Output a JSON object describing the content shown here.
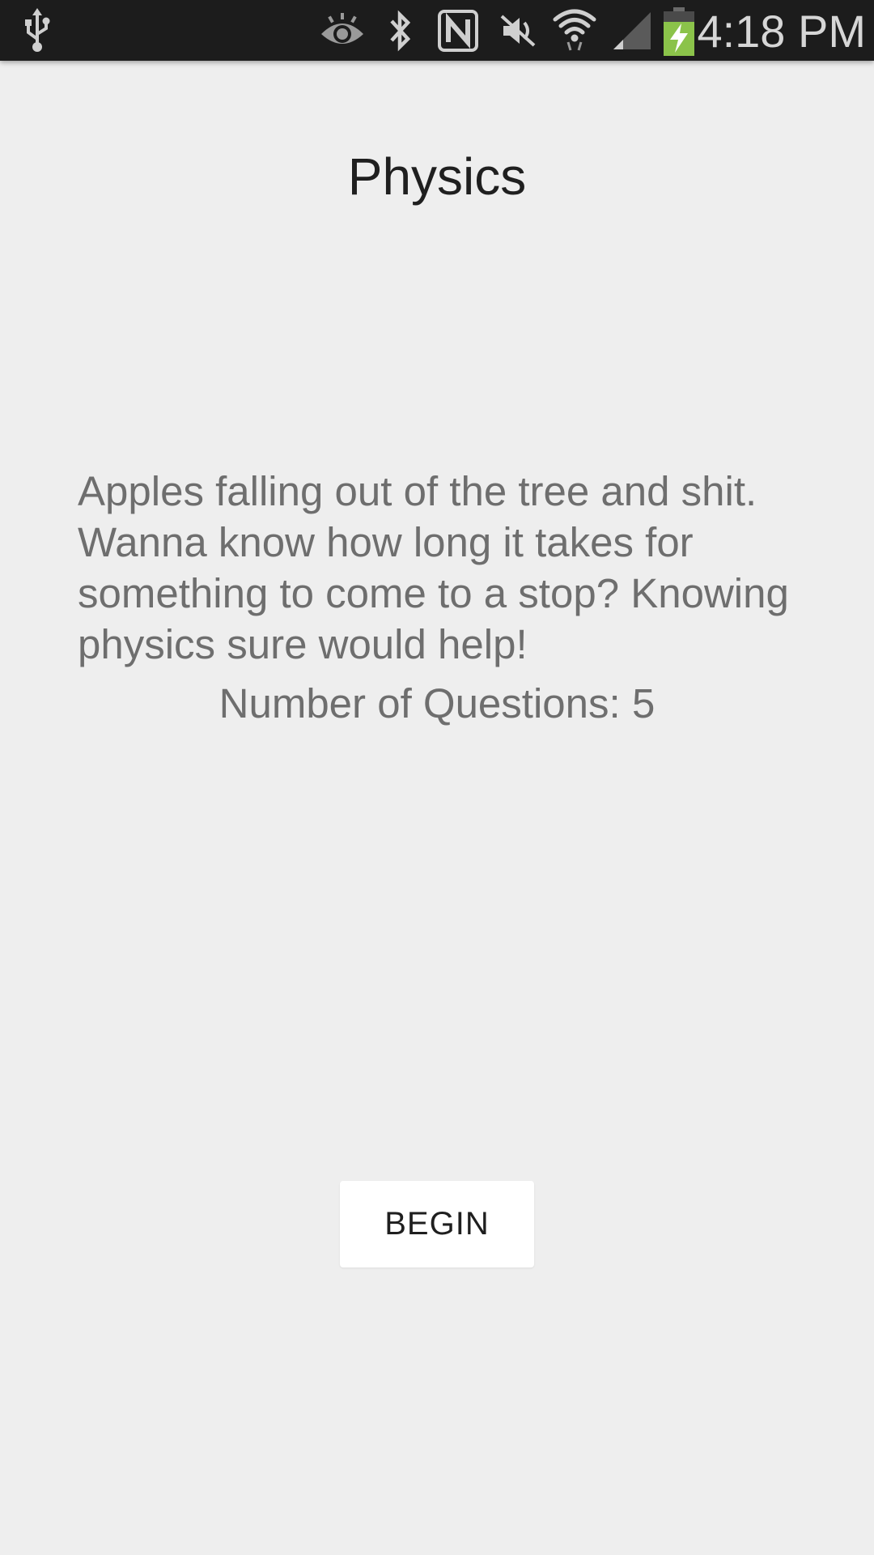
{
  "status_bar": {
    "time": "4:18 PM",
    "icons": [
      "usb-icon",
      "eye-icon",
      "bluetooth-icon",
      "nfc-icon",
      "mute-icon",
      "wifi-icon",
      "signal-icon",
      "battery-charging-icon"
    ],
    "battery_color": "#8bc34a"
  },
  "quiz": {
    "title": "Physics",
    "description": "Apples falling out of the tree and shit. Wanna know how long it takes for something to come to a stop? Knowing physics sure would help!",
    "question_count_label": "Number of Questions:",
    "question_count": "5",
    "begin_label": "BEGIN"
  }
}
